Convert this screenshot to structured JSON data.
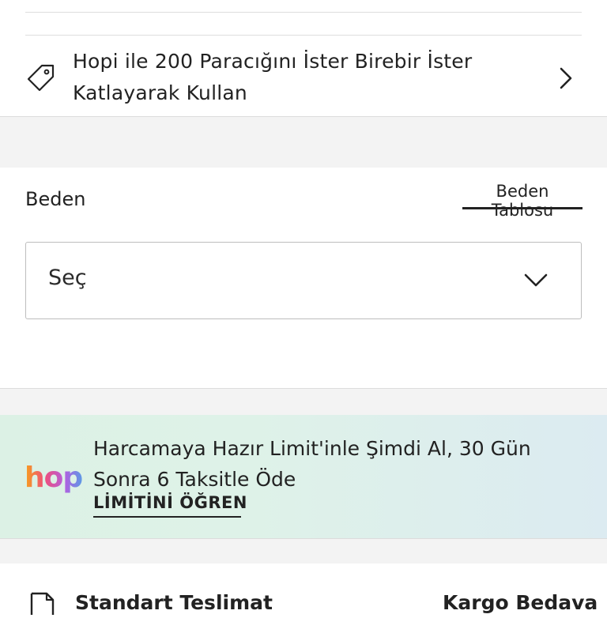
{
  "promo": {
    "text": "Hopi ile 200 Paracığını İster Birebir İster Katlayarak Kullan",
    "icon": "tag-icon",
    "chevron": "chevron-right-icon"
  },
  "size": {
    "label": "Beden",
    "table_link": "Beden Tablosu",
    "select_value": "Seç",
    "select_icon": "chevron-down-icon"
  },
  "hopi_banner": {
    "logo": "hopi",
    "text": "Harcamaya Hazır Limit'inle Şimdi Al, 30 Gün Sonra 6 Taksitle Öde",
    "link": "LİMİTİNİ ÖĞREN"
  },
  "delivery": {
    "label": "Standart Teslimat",
    "price": "Kargo Bedava",
    "icon": "document-icon"
  },
  "colors": {
    "text": "#222222",
    "gray_band": "#f3f3f3",
    "border": "#bdbdbd",
    "banner_green": "#dcf1e5",
    "banner_blue": "#dcebf1"
  }
}
